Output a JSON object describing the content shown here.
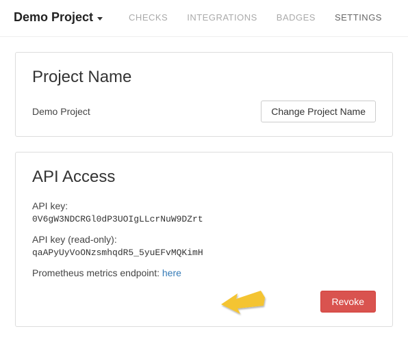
{
  "navbar": {
    "project_name": "Demo Project",
    "tabs": {
      "checks": "CHECKS",
      "integrations": "INTEGRATIONS",
      "badges": "BADGES",
      "settings": "SETTINGS"
    }
  },
  "project_panel": {
    "heading": "Project Name",
    "value": "Demo Project",
    "change_btn": "Change Project Name"
  },
  "api_panel": {
    "heading": "API Access",
    "api_key_label": "API key:",
    "api_key_value": "0V6gW3NDCRGl0dP3UOIgLLcrNuW9DZrt",
    "api_key_ro_label": "API key (read-only):",
    "api_key_ro_value": "qaAPyUyVoONzsmhqdR5_5yuEFvMQKimH",
    "prometheus_label": "Prometheus metrics endpoint: ",
    "prometheus_link": "here",
    "revoke_btn": "Revoke"
  }
}
